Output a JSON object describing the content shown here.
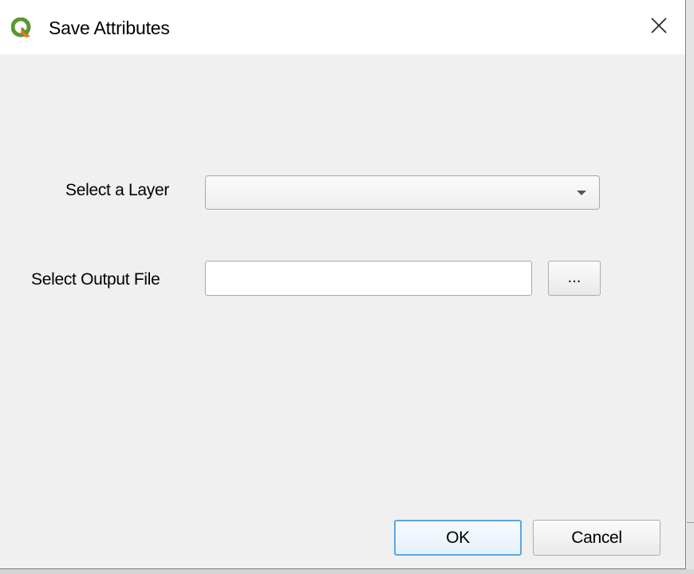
{
  "window": {
    "title": "Save Attributes",
    "app_icon": "qgis-icon",
    "close_icon": "close-icon"
  },
  "form": {
    "layer_label": "Select a Layer",
    "layer_value": "",
    "output_label": "Select Output File",
    "output_value": "",
    "browse_label": "..."
  },
  "buttons": {
    "ok_label": "OK",
    "cancel_label": "Cancel"
  },
  "colors": {
    "qgis_green": "#589632",
    "qgis_yellow": "#ee7913",
    "ok_border": "#5ba6e0"
  }
}
